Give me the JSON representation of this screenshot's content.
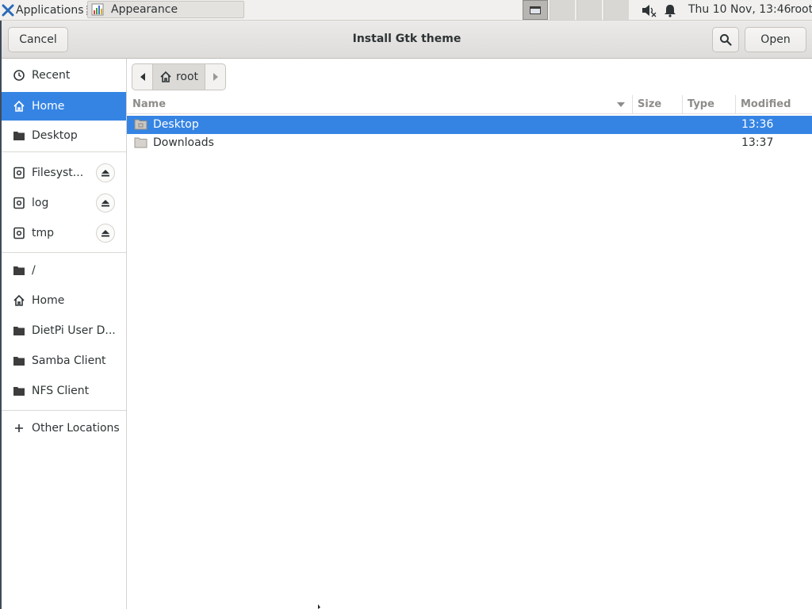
{
  "panel": {
    "applications_label": "Applications",
    "task_label": "Appearance",
    "clock": "Thu 10 Nov, 13:46",
    "user": "root",
    "icons": [
      "xfce-logo-icon",
      "appearance-app-icon",
      "volume-muted-icon",
      "bell-icon"
    ]
  },
  "dialog": {
    "title": "Install Gtk theme",
    "cancel_label": "Cancel",
    "open_label": "Open",
    "search_icon": "search-icon"
  },
  "sidebar": {
    "items": [
      {
        "label": "Recent",
        "icon": "clock-icon"
      },
      {
        "label": "Home",
        "icon": "home-icon",
        "selected": true
      },
      {
        "label": "Desktop",
        "icon": "folder-icon"
      },
      {
        "label": "Filesyst...",
        "icon": "drive-icon",
        "eject": true
      },
      {
        "label": "log",
        "icon": "drive-icon",
        "eject": true
      },
      {
        "label": "tmp",
        "icon": "drive-icon",
        "eject": true
      },
      {
        "label": "/",
        "icon": "folder-icon"
      },
      {
        "label": "Home",
        "icon": "home-icon"
      },
      {
        "label": "DietPi User D...",
        "icon": "folder-icon"
      },
      {
        "label": "Samba Client",
        "icon": "folder-icon"
      },
      {
        "label": "NFS Client",
        "icon": "folder-icon"
      },
      {
        "label": "Other Locations",
        "icon": "plus-icon"
      }
    ]
  },
  "pathbar": {
    "crumb": "root"
  },
  "filelist": {
    "columns": {
      "name": "Name",
      "size": "Size",
      "type": "Type",
      "modified": "Modified"
    },
    "rows": [
      {
        "name": "Desktop",
        "size": "",
        "type": "",
        "modified": "13:36",
        "selected": true
      },
      {
        "name": "Downloads",
        "size": "",
        "type": "",
        "modified": "13:37",
        "selected": false
      }
    ]
  },
  "colors": {
    "accent": "#3584e4",
    "headerbar": "#e4e2e0",
    "panel": "#f1f0ee"
  }
}
